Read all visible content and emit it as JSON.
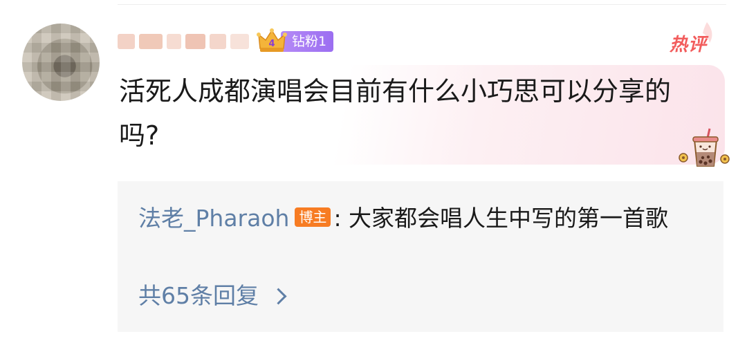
{
  "comment": {
    "fan_badge": {
      "label": "钻粉1",
      "level_digit": "4",
      "icon": "crown-icon"
    },
    "hot_tag": "热评",
    "text": "活死人成都演唱会目前有什么小巧思可以分享的吗?",
    "decoration_icon": "boba-tea-sticker-icon"
  },
  "reply_preview": {
    "author": "法老_Pharaoh",
    "author_badge": "博主",
    "separator": ": ",
    "text": "大家都会唱人生中写的第一首歌",
    "count_label": "共65条回复",
    "more_icon": "chevron-right-icon"
  },
  "colors": {
    "link_blue": "#5f7fa6",
    "fan_badge_purple": "#9b6ef1",
    "hot_red": "#f25c5c",
    "blogger_orange": "#f77c23",
    "reply_bg": "#f6f6f6"
  }
}
